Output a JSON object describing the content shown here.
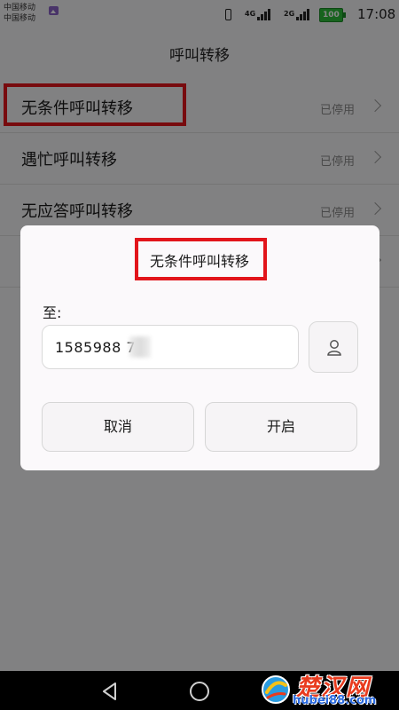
{
  "status_bar": {
    "carrier_line1": "中国移动",
    "carrier_line2": "中国移动",
    "net_label_1": "4G",
    "net_label_2": "2G",
    "battery": "100",
    "time": "17:08",
    "battery_color": "#2dbb3a"
  },
  "header": {
    "title": "呼叫转移"
  },
  "list": {
    "items": [
      {
        "label": "无条件呼叫转移",
        "status": "已停用"
      },
      {
        "label": "遇忙呼叫转移",
        "status": "已停用"
      },
      {
        "label": "无应答呼叫转移",
        "status": "已停用"
      },
      {
        "label": "",
        "status": ""
      }
    ]
  },
  "dialog": {
    "title": "无条件呼叫转移",
    "to_label": "至:",
    "number_value": "1585988     7",
    "cancel_label": "取消",
    "enable_label": "开启"
  },
  "watermark": {
    "name": "楚汉网",
    "url": "hubei88.com"
  },
  "colors": {
    "highlight_border": "#e2151b",
    "overlay": "rgba(0,0,0,0.47)"
  },
  "icons": {
    "contact": "person-icon",
    "nav_back": "triangle-back-icon",
    "nav_home": "circle-home-icon",
    "gallery": "gallery-icon",
    "vibrate": "vibrate-icon"
  }
}
